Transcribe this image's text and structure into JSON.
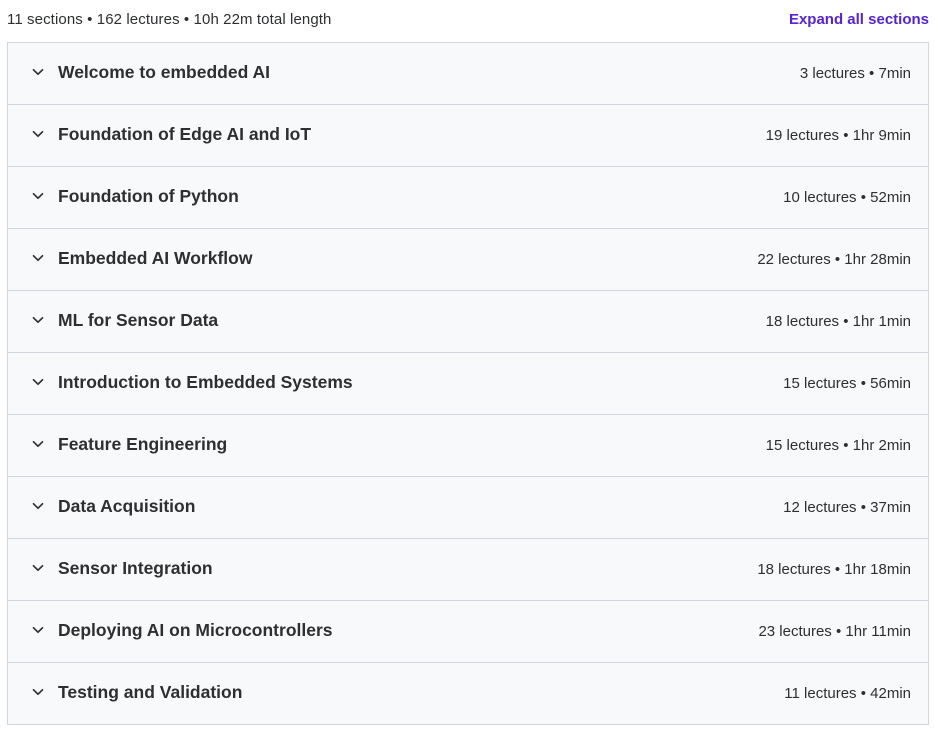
{
  "summary": {
    "text": "11 sections • 162 lectures • 10h 22m total length",
    "expand_label": "Expand all sections"
  },
  "colors": {
    "accent": "#5624d0",
    "row_background": "#f7f9fa",
    "border": "#d1d7dc",
    "text": "#2d2f31"
  },
  "sections": [
    {
      "title": "Welcome to embedded AI",
      "meta": "3 lectures • 7min",
      "icon": "chevron-down-icon"
    },
    {
      "title": "Foundation of Edge AI and IoT",
      "meta": "19 lectures • 1hr 9min",
      "icon": "chevron-down-icon"
    },
    {
      "title": "Foundation of Python",
      "meta": "10 lectures • 52min",
      "icon": "chevron-down-icon"
    },
    {
      "title": "Embedded AI Workflow",
      "meta": "22 lectures • 1hr 28min",
      "icon": "chevron-down-icon"
    },
    {
      "title": "ML for Sensor Data",
      "meta": "18 lectures • 1hr 1min",
      "icon": "chevron-down-icon"
    },
    {
      "title": "Introduction to Embedded Systems",
      "meta": "15 lectures • 56min",
      "icon": "chevron-down-icon"
    },
    {
      "title": "Feature Engineering",
      "meta": "15 lectures • 1hr 2min",
      "icon": "chevron-down-icon"
    },
    {
      "title": "Data Acquisition",
      "meta": "12 lectures • 37min",
      "icon": "chevron-down-icon"
    },
    {
      "title": "Sensor Integration",
      "meta": "18 lectures • 1hr 18min",
      "icon": "chevron-down-icon"
    },
    {
      "title": "Deploying AI on Microcontrollers",
      "meta": "23 lectures • 1hr 11min",
      "icon": "chevron-down-icon"
    },
    {
      "title": "Testing and Validation",
      "meta": "11 lectures • 42min",
      "icon": "chevron-down-icon"
    }
  ]
}
